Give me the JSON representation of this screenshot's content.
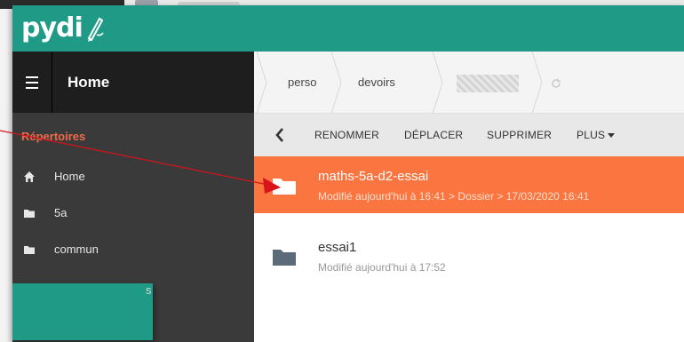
{
  "app": {
    "logo_text": "pydi"
  },
  "sidebar": {
    "title": "Home",
    "section_label": "Répertoires",
    "items": [
      {
        "label": "Home",
        "icon": "home-icon"
      },
      {
        "label": "5a",
        "icon": "folder-icon"
      },
      {
        "label": "commun",
        "icon": "folder-icon"
      }
    ],
    "partial_item_tail": "s"
  },
  "breadcrumb": {
    "items": [
      "perso",
      "devoirs"
    ]
  },
  "toolbar": {
    "rename": "RENOMMER",
    "move": "DÉPLACER",
    "delete": "SUPPRIMER",
    "more": "PLUS"
  },
  "files": [
    {
      "name": "maths-5a-d2-essai",
      "meta": "Modifié aujourd'hui à 16:41 > Dossier > 17/03/2020 16:41",
      "selected": true
    },
    {
      "name": "essai1",
      "meta": "Modifié aujourd'hui à 17:52",
      "selected": false
    }
  ],
  "colors": {
    "brand": "#1f9a86",
    "selected_row": "#fb7540",
    "section_accent": "#f06a4a",
    "annotation": "#d9121b"
  }
}
